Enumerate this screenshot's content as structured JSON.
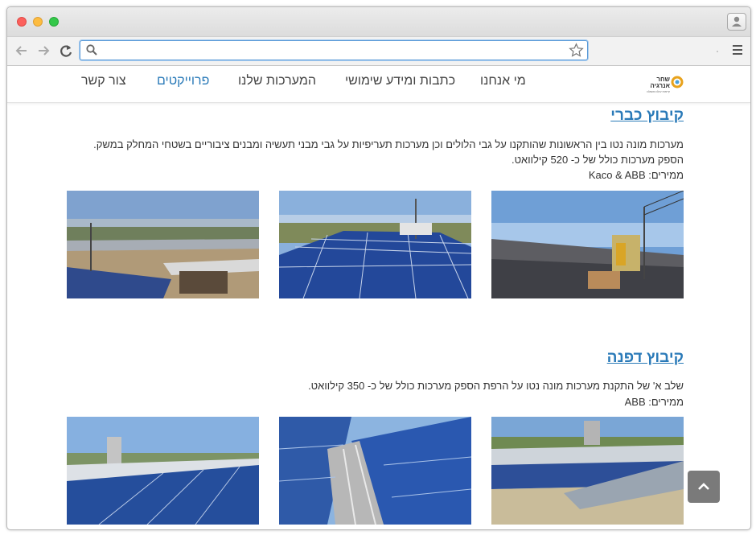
{
  "browser": {
    "address_value": "",
    "icons": {
      "back": "back-arrow-icon",
      "forward": "forward-arrow-icon",
      "reload": "reload-icon",
      "search": "search-icon",
      "star": "star-icon",
      "menu": "menu-icon",
      "profile": "profile-icon"
    }
  },
  "site": {
    "logo": {
      "name": "שחר",
      "name2": "אנרגיה",
      "tagline": "קיימות עולם מושלם"
    },
    "nav": {
      "about": "מי אנחנו",
      "articles": "כתבות ומידע שימושי",
      "systems": "המערכות שלנו",
      "projects": "פרוייקטים",
      "contact": "צור קשר"
    },
    "active_color": "#2a7ab8"
  },
  "projects": [
    {
      "title": "קיבוץ כברי",
      "description_line1": "מערכות מונה נטו בין הראשונות שהותקנו על גבי הלולים וכן מערכות תעריפיות על גבי מבני תעשיה ומבנים ציבוריים בשטחי המחלק במשק.",
      "description_line2": "הספק מערכות כולל של כ- 520 קילוואט.",
      "inverters": "ממירים: Kaco & ABB"
    },
    {
      "title": "קיבוץ דפנה",
      "description_line1": "שלב א' של התקנת מערכות מונה נטו על הרפת הספק מערכות כולל של כ- 350 קילוואט.",
      "inverters": "ממירים: ABB"
    }
  ],
  "scroll_top_icon": "chevron-up-icon"
}
